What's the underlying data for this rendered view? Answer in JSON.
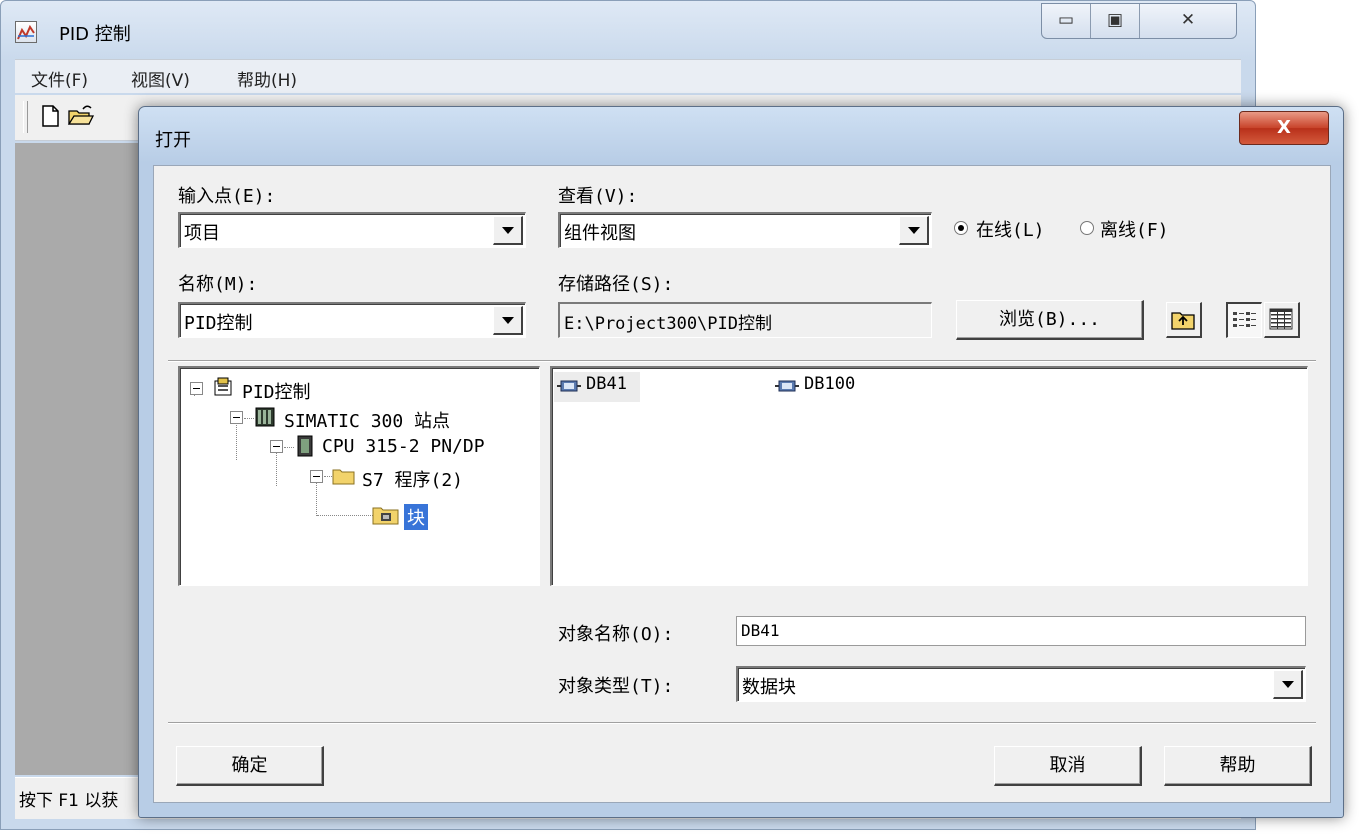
{
  "parent_window": {
    "title": "PID 控制",
    "controls": {
      "minimize": "▭",
      "maximize": "▣",
      "close": "✕"
    },
    "menu": [
      "文件(F)",
      "视图(V)",
      "帮助(H)"
    ],
    "toolbar_icons": [
      "new-document-icon",
      "open-folder-icon"
    ],
    "status_text": "按下 F1 以获"
  },
  "dialog": {
    "title": "打开",
    "close_label": "X",
    "entry_point": {
      "label": "输入点(E):",
      "value": "项目"
    },
    "view": {
      "label": "查看(V):",
      "value": "组件视图"
    },
    "online": {
      "label": "在线(L)",
      "checked": true
    },
    "offline": {
      "label": "离线(F)",
      "checked": false
    },
    "name": {
      "label": "名称(M):",
      "value": "PID控制"
    },
    "storage_path": {
      "label": "存储路径(S):",
      "value": "E:\\Project300\\PID控制"
    },
    "browse_label": "浏览(B)...",
    "tree": [
      {
        "label": "PID控制",
        "icon": "project-icon"
      },
      {
        "label": "SIMATIC 300 站点",
        "icon": "station-icon"
      },
      {
        "label": "CPU 315-2 PN/DP",
        "icon": "cpu-icon"
      },
      {
        "label": "S7 程序(2)",
        "icon": "folder-icon"
      },
      {
        "label": "块",
        "icon": "blocks-folder-icon",
        "selected": true
      }
    ],
    "list": [
      {
        "label": "DB41",
        "icon": "data-block-icon"
      },
      {
        "label": "DB100",
        "icon": "data-block-icon"
      }
    ],
    "object_name": {
      "label": "对象名称(O):",
      "value": "DB41"
    },
    "object_type": {
      "label": "对象类型(T):",
      "value": "数据块"
    },
    "ok_label": "确定",
    "cancel_label": "取消",
    "help_label": "帮助"
  }
}
